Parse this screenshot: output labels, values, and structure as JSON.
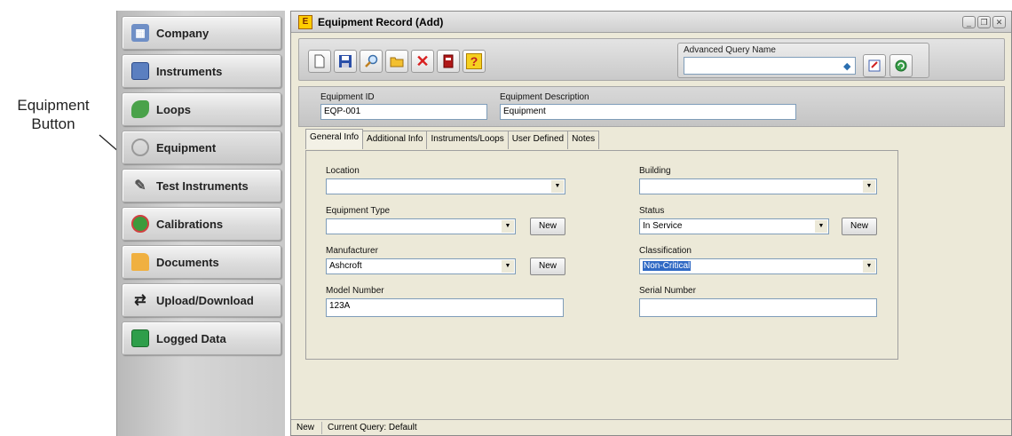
{
  "callout": {
    "line1": "Equipment",
    "line2": "Button"
  },
  "sidebar": {
    "items": [
      {
        "label": "Company",
        "icon": "building-icon"
      },
      {
        "label": "Instruments",
        "icon": "calculator-icon"
      },
      {
        "label": "Loops",
        "icon": "loop-icon"
      },
      {
        "label": "Equipment",
        "icon": "magnifier-icon"
      },
      {
        "label": "Test Instruments",
        "icon": "test-probe-icon"
      },
      {
        "label": "Calibrations",
        "icon": "gauge-icon"
      },
      {
        "label": "Documents",
        "icon": "folder-icon"
      },
      {
        "label": "Upload/Download",
        "icon": "transfer-icon"
      },
      {
        "label": "Logged Data",
        "icon": "data-log-icon"
      }
    ]
  },
  "window": {
    "title": "Equipment Record (Add)",
    "logo_letter": "E",
    "controls": {
      "minimize": "_",
      "restore": "❐",
      "close": "✕"
    }
  },
  "toolbar": {
    "buttons": [
      "new-icon",
      "save-icon",
      "search-icon",
      "open-folder-icon",
      "delete-icon",
      "book-icon",
      "help-icon"
    ],
    "help_glyph": "?",
    "delete_glyph": "✕",
    "advanced_query_label": "Advanced Query Name"
  },
  "record": {
    "equipment_id_label": "Equipment ID",
    "equipment_id_value": "EQP-001",
    "equipment_description_label": "Equipment Description",
    "equipment_description_value": "Equipment"
  },
  "tabs": [
    "General Info",
    "Additional Info",
    "Instruments/Loops",
    "User Defined",
    "Notes"
  ],
  "form": {
    "location_label": "Location",
    "location_value": "",
    "building_label": "Building",
    "building_value": "",
    "equipment_type_label": "Equipment Type",
    "equipment_type_value": "",
    "status_label": "Status",
    "status_value": "In Service",
    "manufacturer_label": "Manufacturer",
    "manufacturer_value": "Ashcroft",
    "classification_label": "Classification",
    "classification_value": "Non-Critical",
    "model_number_label": "Model Number",
    "model_number_value": "123A",
    "serial_number_label": "Serial Number",
    "serial_number_value": "",
    "new_button_label": "New"
  },
  "status_bar": {
    "mode": "New",
    "query": "Current Query: Default"
  },
  "colors": {
    "selection": "#316ac5",
    "window_bg": "#ece9d8",
    "input_border": "#7f9db9"
  }
}
